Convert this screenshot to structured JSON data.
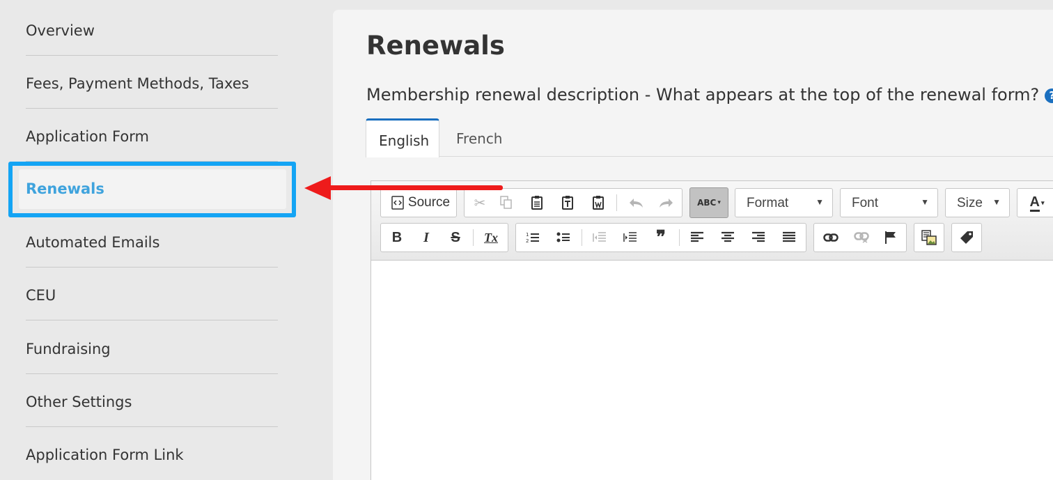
{
  "sidebar": {
    "items": [
      {
        "label": "Overview"
      },
      {
        "label": "Fees, Payment Methods, Taxes"
      },
      {
        "label": "Application Form"
      },
      {
        "label": "Renewals",
        "active": true
      },
      {
        "label": "Automated Emails"
      },
      {
        "label": "CEU"
      },
      {
        "label": "Fundraising"
      },
      {
        "label": "Other Settings"
      },
      {
        "label": "Application Form Link"
      }
    ],
    "active_color": "#3fa3dd",
    "highlight_color": "#14a4f4"
  },
  "main": {
    "title": "Renewals",
    "description": "Membership renewal description - What appears at the top of the renewal form?",
    "help_icon": "?",
    "tabs": [
      {
        "label": "English",
        "active": true
      },
      {
        "label": "French"
      }
    ]
  },
  "editor": {
    "toolbar": {
      "source_label": "Source",
      "format_label": "Format",
      "font_label": "Font",
      "size_label": "Size",
      "text_color_label": "A",
      "spellcheck_label": "ABC",
      "bold": "B",
      "italic": "I",
      "strike": "S",
      "remove_format": "Tx"
    }
  },
  "annotation": {
    "arrow_color": "#ee1b1b"
  }
}
